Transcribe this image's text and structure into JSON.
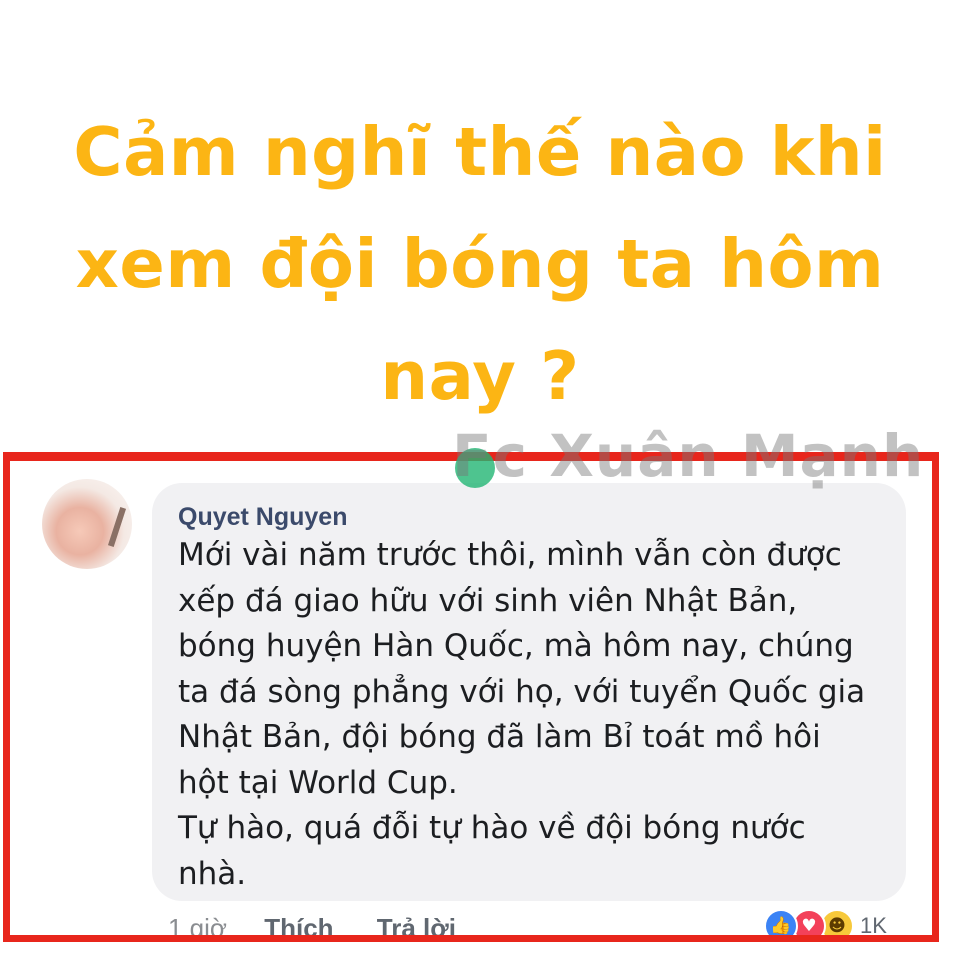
{
  "headline": {
    "lines": [
      "Cảm nghĩ thế nào khi",
      "xem đội bóng ta hôm",
      "nay ?"
    ]
  },
  "watermark": {
    "text": "Fc Xuân Mạnh"
  },
  "comment": {
    "author": "Quyet Nguyen",
    "lines": [
      "Mới vài năm trước thôi, mình vẫn còn được",
      "xếp đá giao hữu với sinh viên Nhật Bản,",
      "bóng huyện Hàn Quốc, mà hôm nay, chúng",
      "ta đá sòng phẳng với họ, với tuyển Quốc gia",
      "Nhật Bản, đội bóng đã làm Bỉ toát mồ hôi",
      "hột tại World Cup.",
      "Tự hào, quá đỗi tự hào về đội bóng nước",
      "nhà."
    ],
    "time": "1 giờ",
    "like_label": "Thích",
    "reply_label": "Trả lời",
    "reaction_count": "1K",
    "reactions": [
      "like-icon",
      "love-icon",
      "haha-icon"
    ]
  },
  "colors": {
    "headline": "#fcb514",
    "frame": "#e8261c",
    "bubble": "#f1f1f3"
  }
}
